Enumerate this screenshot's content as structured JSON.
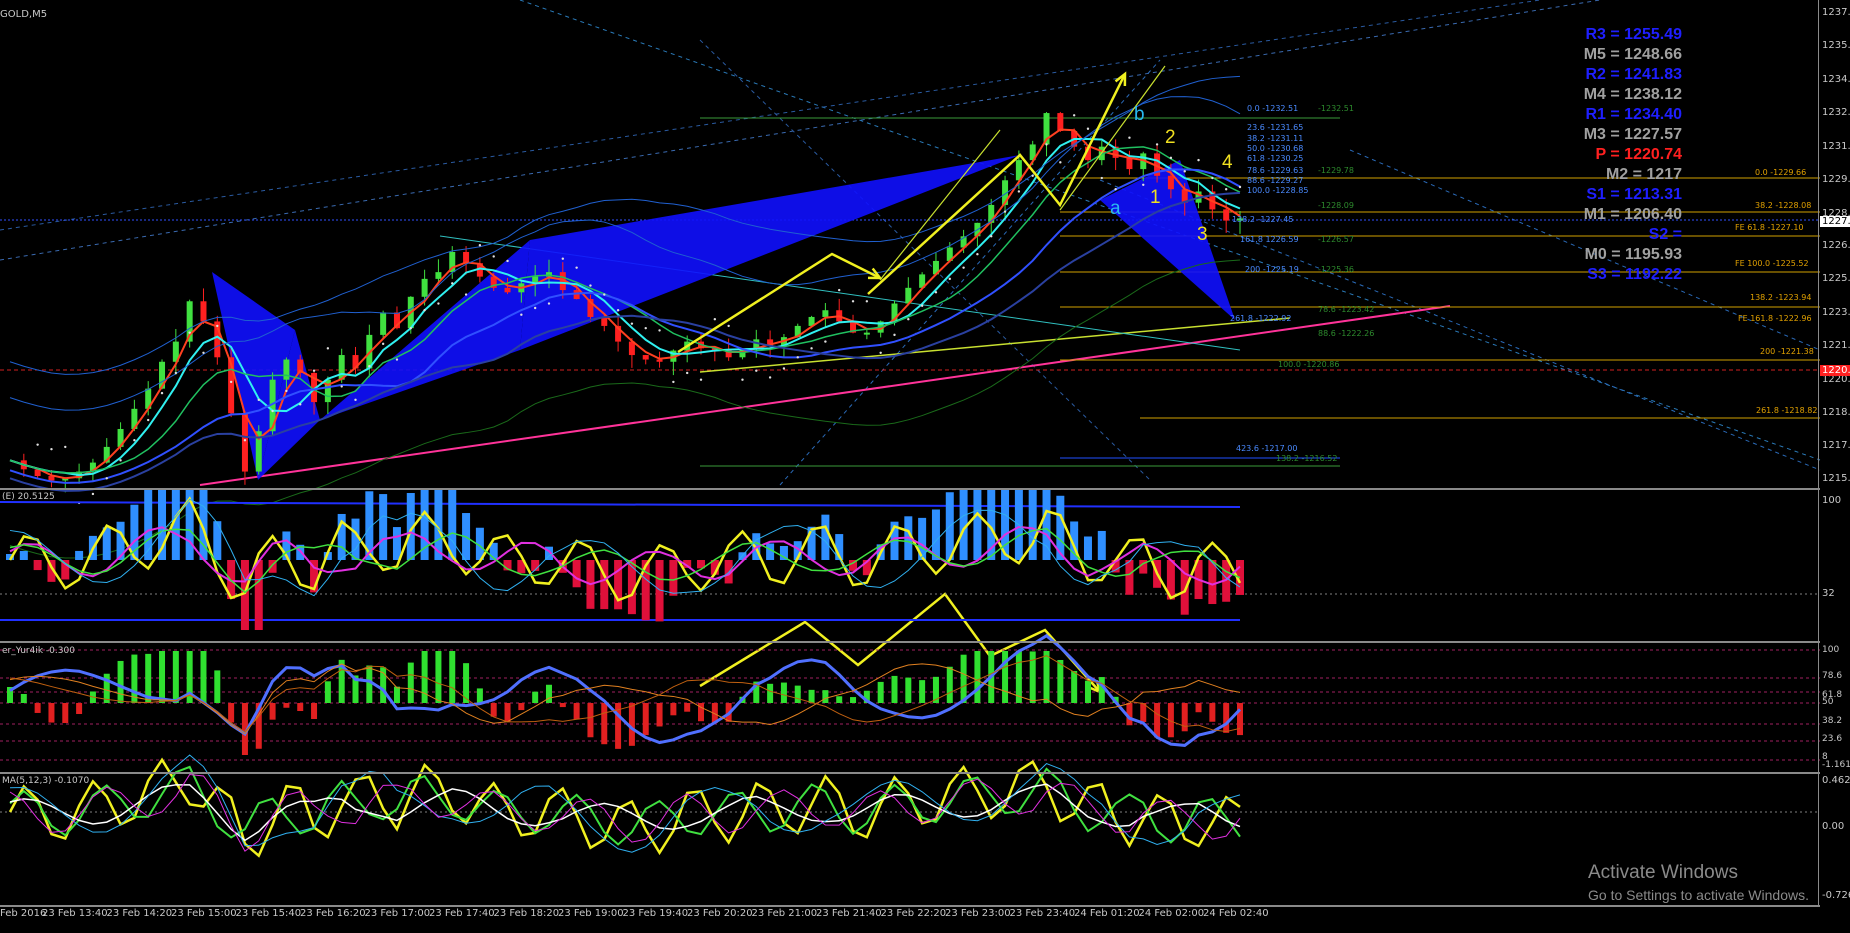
{
  "window": {
    "symbol_label": "GOLD,M5"
  },
  "pivots": [
    {
      "text": "R3 = 1255.49",
      "color": "#1f1fff"
    },
    {
      "text": "M5 = 1248.66",
      "color": "#a0a0a0"
    },
    {
      "text": "R2 = 1241.83",
      "color": "#1f1fff"
    },
    {
      "text": "M4 = 1238.12",
      "color": "#a0a0a0"
    },
    {
      "text": "R1 = 1234.40",
      "color": "#1f1fff"
    },
    {
      "text": "M3 = 1227.57",
      "color": "#a0a0a0"
    },
    {
      "text": "P  = 1220.74",
      "color": "#ff2020"
    },
    {
      "text": "M2 = 1217",
      "color": "#a0a0a0"
    },
    {
      "text": "S1 = 1213.31",
      "color": "#1f1fff"
    },
    {
      "text": "M1 = 1206.40",
      "color": "#a0a0a0"
    },
    {
      "text": "S2 = ",
      "color": "#1f1fff"
    },
    {
      "text": "M0 = 1195.93",
      "color": "#a0a0a0"
    },
    {
      "text": "S3 = 1192.22",
      "color": "#1f1fff"
    }
  ],
  "price_axis": [
    "1237.0",
    "1235.6",
    "1234.1",
    "1232.6",
    "1231.1",
    "1229.6",
    "1228.1",
    "1227.7",
    "1226.6",
    "1225.0",
    "1223.5",
    "1221.9",
    "1220.4",
    "1218.9",
    "1217.3",
    "1215.8"
  ],
  "current_price": "1227.7",
  "red_level_label": "1220.9",
  "fib_levels": [
    {
      "text": "0.0 -1232.51",
      "color": "#4a8aff"
    },
    {
      "text": "-1232.51",
      "color": "#2d8a2d"
    },
    {
      "text": "23.6 -1231.65",
      "color": "#4a8aff"
    },
    {
      "text": "38.2 -1231.11",
      "color": "#4a8aff"
    },
    {
      "text": "50.0 -1230.68",
      "color": "#4a8aff"
    },
    {
      "text": "61.8 -1230.25",
      "color": "#4a8aff"
    },
    {
      "text": "78.6 -1229.63",
      "color": "#4a8aff"
    },
    {
      "text": "-1229.78",
      "color": "#2d8a2d"
    },
    {
      "text": "0.0 -1229.66",
      "color": "#e0a000"
    },
    {
      "text": "88.6 -1229.27",
      "color": "#4a8aff"
    },
    {
      "text": "100.0 -1228.85",
      "color": "#4a8aff"
    },
    {
      "text": "-1228.09",
      "color": "#2d8a2d"
    },
    {
      "text": "38.2 -1228.08",
      "color": "#e0a000"
    },
    {
      "text": "138.2 -1227.45",
      "color": "#4a8aff"
    },
    {
      "text": "FE 61.8 -1227.10",
      "color": "#e0a000"
    },
    {
      "text": "161.8 1226.59",
      "color": "#4a8aff"
    },
    {
      "text": "-1226.57",
      "color": "#2d8a2d"
    },
    {
      "text": "200 -1225.19",
      "color": "#4a8aff"
    },
    {
      "text": "-1225.36",
      "color": "#2d8a2d"
    },
    {
      "text": "FE 100.0 -1225.52",
      "color": "#e0a000"
    },
    {
      "text": "138.2 -1223.94",
      "color": "#e0a000"
    },
    {
      "text": "78.6 -1223.42",
      "color": "#2d8a2d"
    },
    {
      "text": "261.8 -1222.92",
      "color": "#4a8aff"
    },
    {
      "text": "FE 161.8 -1222.96",
      "color": "#e0a000"
    },
    {
      "text": "88.6 -1222.26",
      "color": "#2d8a2d"
    },
    {
      "text": "200 -1221.38",
      "color": "#e0a000"
    },
    {
      "text": "100.0 -1220.86",
      "color": "#2d8a2d"
    },
    {
      "text": "261.8 -1218.82",
      "color": "#e0a000"
    },
    {
      "text": "423.6 -1217.00",
      "color": "#4a8aff"
    },
    {
      "text": "138.2 -1216.52",
      "color": "#2d8a2d"
    }
  ],
  "wave_labels": [
    {
      "text": "b",
      "color": "#28b8f0"
    },
    {
      "text": "2",
      "color": "#f0e020"
    },
    {
      "text": "4",
      "color": "#f0e020"
    },
    {
      "text": "a",
      "color": "#28b8f0"
    },
    {
      "text": "1",
      "color": "#f0e020"
    },
    {
      "text": "3",
      "color": "#f0e020"
    }
  ],
  "indicators": {
    "panel1": {
      "title": "(E) 20.5125",
      "axis": [
        "100",
        "32"
      ]
    },
    "panel2": {
      "title": "er_Yur4ik -0.300",
      "axis": [
        "100",
        "78.6",
        "61.8",
        "50",
        "38.2",
        "23.6",
        "8",
        "-1.161"
      ]
    },
    "panel3": {
      "title": "MA(5,12,3) -0.1070",
      "axis": [
        "0.4625",
        "0.00",
        "-0.7267"
      ]
    }
  },
  "time_axis": [
    "Feb 2016",
    "23 Feb 13:40",
    "23 Feb 14:20",
    "23 Feb 15:00",
    "23 Feb 15:40",
    "23 Feb 16:20",
    "23 Feb 17:00",
    "23 Feb 17:40",
    "23 Feb 18:20",
    "23 Feb 19:00",
    "23 Feb 19:40",
    "23 Feb 20:20",
    "23 Feb 21:00",
    "23 Feb 21:40",
    "23 Feb 22:20",
    "23 Feb 23:00",
    "23 Feb 23:40",
    "24 Feb 01:20",
    "24 Feb 02:00",
    "24 Feb 02:40"
  ],
  "watermark": {
    "title": "Activate Windows",
    "subtitle": "Go to Settings to activate Windows."
  },
  "colors": {
    "bull": "#40e040",
    "bear": "#ff2020",
    "hist_up": "#2f8fff",
    "hist_down": "#e0103a",
    "pattern_fill": "#1010ff",
    "arrow": "#f0f020",
    "pink_trend": "#ff3399"
  },
  "chart_data": {
    "type": "candlestick",
    "symbol": "GOLD,M5",
    "ylim": [
      1215.8,
      1237.0
    ],
    "x_labels": [
      "Feb 2016",
      "23 Feb 13:40",
      "23 Feb 14:20",
      "23 Feb 15:00",
      "23 Feb 15:40",
      "23 Feb 16:20",
      "23 Feb 17:00",
      "23 Feb 17:40",
      "23 Feb 18:20",
      "23 Feb 19:00",
      "23 Feb 19:40",
      "23 Feb 20:20",
      "23 Feb 21:00",
      "23 Feb 21:40",
      "23 Feb 22:20",
      "23 Feb 23:00",
      "23 Feb 23:40",
      "24 Feb 01:20",
      "24 Feb 02:00",
      "24 Feb 02:40"
    ],
    "close_path": [
      1216.9,
      1216.5,
      1216.2,
      1216.0,
      1216.1,
      1216.4,
      1216.8,
      1217.5,
      1218.3,
      1219.2,
      1220.1,
      1221.3,
      1222.2,
      1224.0,
      1223.1,
      1221.5,
      1219.0,
      1216.4,
      1218.2,
      1220.5,
      1221.4,
      1220.8,
      1219.5,
      1220.5,
      1221.6,
      1221.0,
      1222.5,
      1223.5,
      1222.8,
      1224.2,
      1225.0,
      1225.3,
      1226.2,
      1225.7,
      1225.1,
      1224.6,
      1224.4,
      1224.8,
      1225.1,
      1225.3,
      1224.5,
      1224.1,
      1223.3,
      1222.9,
      1222.2,
      1221.6,
      1221.4,
      1221.3,
      1221.8,
      1222.2,
      1221.9,
      1221.8,
      1221.5,
      1221.9,
      1222.3,
      1222.0,
      1222.4,
      1222.9,
      1223.3,
      1223.6,
      1223.1,
      1222.6,
      1222.6,
      1223.1,
      1223.9,
      1224.6,
      1225.2,
      1225.8,
      1226.4,
      1226.9,
      1227.5,
      1228.3,
      1229.4,
      1230.3,
      1231.0,
      1232.4,
      1231.6,
      1230.9,
      1230.3,
      1230.9,
      1230.4,
      1229.9,
      1230.6,
      1229.6,
      1229.0,
      1228.4,
      1228.9,
      1228.1,
      1227.6,
      1227.7
    ]
  }
}
